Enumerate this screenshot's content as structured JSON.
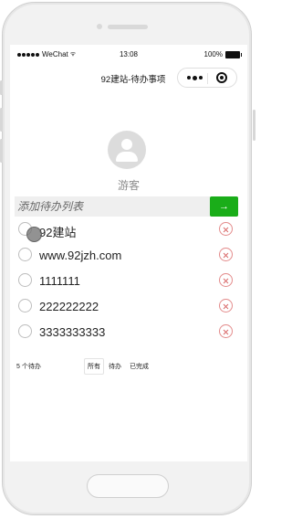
{
  "status_bar": {
    "carrier": "WeChat",
    "time": "13:08",
    "battery_text": "100%",
    "battery_level": 1.0
  },
  "nav": {
    "title": "92建站-待办事项",
    "more_icon": "ellipsis-icon",
    "close_icon": "capsule-close-icon"
  },
  "user": {
    "avatar_icon": "default-avatar-icon",
    "nickname": "游客"
  },
  "add_todo": {
    "placeholder": "添加待办列表",
    "button_label": "→",
    "button_color": "#1aad19"
  },
  "todos": [
    {
      "text": "92建站",
      "completed": false
    },
    {
      "text": "www.92jzh.com",
      "completed": false
    },
    {
      "text": "1111111",
      "completed": false
    },
    {
      "text": "222222222",
      "completed": false
    },
    {
      "text": "3333333333",
      "completed": false
    }
  ],
  "footer": {
    "count_label": "5 个待办",
    "filters": [
      {
        "label": "所有",
        "active": true
      },
      {
        "label": "待办",
        "active": false
      },
      {
        "label": "已完成",
        "active": false
      }
    ]
  },
  "colors": {
    "delete_icon": "#d96b6b",
    "placeholder": "#666666"
  }
}
